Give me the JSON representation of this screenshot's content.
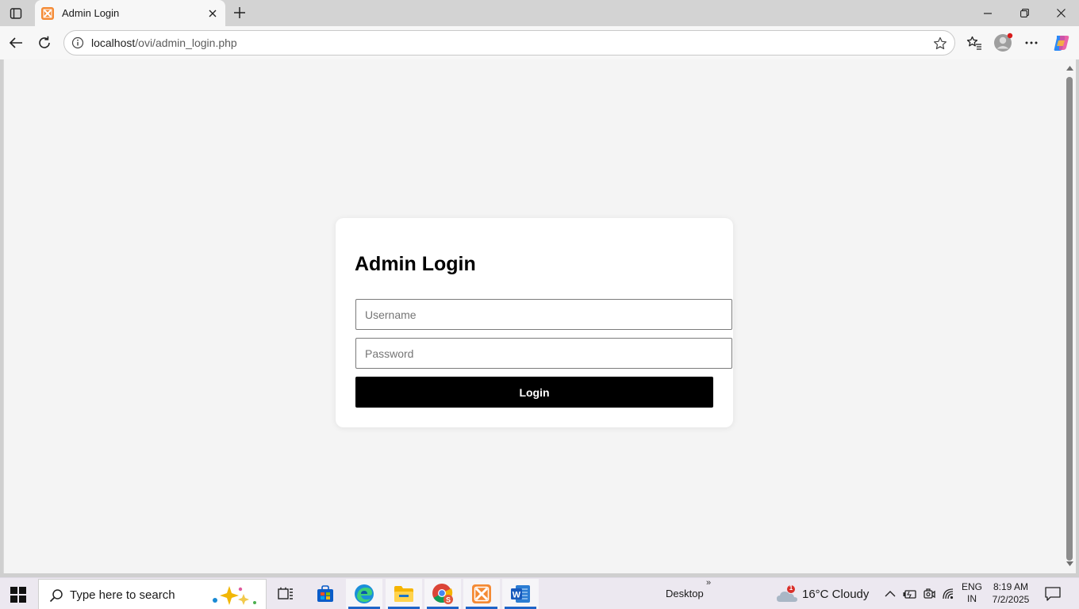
{
  "browser": {
    "tab_title": "Admin Login",
    "url_host": "localhost",
    "url_path": "/ovi/admin_login.php"
  },
  "login": {
    "heading": "Admin Login",
    "username_placeholder": "Username",
    "password_placeholder": "Password",
    "username_value": "",
    "password_value": "",
    "submit_label": "Login"
  },
  "taskbar": {
    "search_placeholder": "Type here to search",
    "desktop_label": "Desktop",
    "more_chevron": "»",
    "weather": "16°C  Cloudy",
    "weather_badge": "1",
    "lang_line1": "ENG",
    "lang_line2": "IN",
    "time": "8:19 AM",
    "date": "7/2/2025"
  },
  "colors": {
    "accent_favicon": "#f48a34",
    "page_background": "#f4f4f4",
    "button": "#000000",
    "taskbar": "#ece8f0",
    "profile_dot": "#d81b1b"
  },
  "icons": [
    "tab-actions-icon",
    "xampp-favicon",
    "close-icon",
    "plus-icon",
    "minimize-icon",
    "restore-icon",
    "back-arrow-icon",
    "reload-icon",
    "info-icon",
    "star-icon",
    "favorites-icon",
    "profile-icon",
    "more-icon",
    "copilot-icon",
    "windows-start-icon",
    "search-icon",
    "task-view-icon",
    "store-icon",
    "edge-icon",
    "file-explorer-icon",
    "chrome-icon",
    "xampp-icon",
    "word-icon",
    "cloud-icon",
    "chevron-up-icon",
    "battery-icon",
    "meet-icon",
    "wifi-icon",
    "notification-icon"
  ]
}
